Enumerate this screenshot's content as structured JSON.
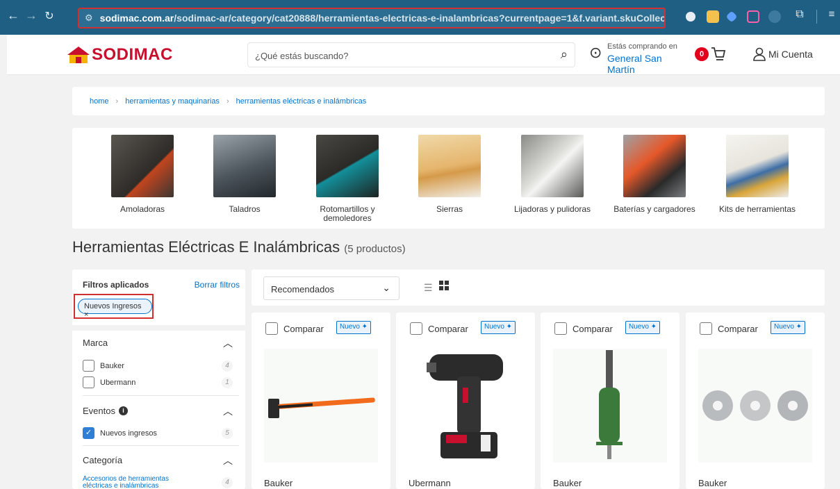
{
  "browser": {
    "url_domain": "sodimac.com.ar",
    "url_path": "/sodimac-ar/category/cat20888/herramientas-electricas-e-inalambricas?currentpage=1&f.variant.skuCollectionIds=..."
  },
  "header": {
    "logo_text": "SODIMAC",
    "search_placeholder": "¿Qué estás buscando?",
    "location_line1": "Estás comprando en",
    "location_line2": "General San Martín",
    "cart_count": "0",
    "account_label": "Mi Cuenta"
  },
  "breadcrumb": [
    "home",
    "herramientas y maquinarias",
    "herramientas eléctricas e inalámbricas"
  ],
  "categories": [
    {
      "label": "Amoladoras",
      "icon": "angle-grinder-photo"
    },
    {
      "label": "Taladros",
      "icon": "drill-photo"
    },
    {
      "label": "Rotomartillos y demoledores",
      "icon": "rotary-hammer-photo"
    },
    {
      "label": "Sierras",
      "icon": "saw-photo"
    },
    {
      "label": "Lijadoras y pulidoras",
      "icon": "sander-photo"
    },
    {
      "label": "Baterías y cargadores",
      "icon": "battery-photo"
    },
    {
      "label": "Kits de herramientas",
      "icon": "toolkit-photo"
    }
  ],
  "page": {
    "title": "Herramientas Eléctricas E Inalámbricas",
    "count": "(5 productos)"
  },
  "filters": {
    "applied_label": "Filtros aplicados",
    "clear_label": "Borrar filtros",
    "chip_label": "Nuevos Ingresos ×",
    "marca": {
      "title": "Marca",
      "options": [
        {
          "label": "Bauker",
          "count": "4",
          "checked": false
        },
        {
          "label": "Ubermann",
          "count": "1",
          "checked": false
        }
      ]
    },
    "eventos": {
      "title": "Eventos",
      "options": [
        {
          "label": "Nuevos ingresos",
          "count": "5",
          "checked": true
        }
      ]
    },
    "categoria": {
      "title": "Categoría",
      "options": [
        {
          "label": "Accesorios de herramientas eléctricas e inalámbricas",
          "count": "4"
        }
      ]
    }
  },
  "sort": {
    "selected": "Recomendados"
  },
  "products": [
    {
      "compare_label": "Comparar",
      "badge": "Nuevo",
      "brand": "Bauker",
      "icon": "sledgehammer-image"
    },
    {
      "compare_label": "Comparar",
      "badge": "Nuevo",
      "brand": "Ubermann",
      "icon": "impact-driver-image"
    },
    {
      "compare_label": "Comparar",
      "badge": "Nuevo",
      "brand": "Bauker",
      "icon": "chisel-image"
    },
    {
      "compare_label": "Comparar",
      "badge": "Nuevo",
      "brand": "Bauker",
      "icon": "diamond-discs-image"
    }
  ],
  "colors": {
    "brand_red": "#c8102e",
    "link_blue": "#0072ce",
    "chrome_blue": "#1f5f84"
  }
}
